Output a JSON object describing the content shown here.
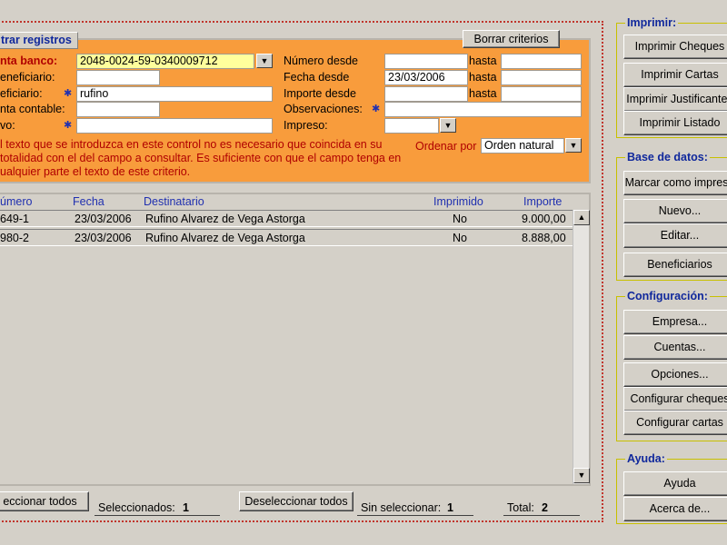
{
  "filter": {
    "title": "trar registros",
    "clear_label": "Borrar criterios",
    "cuenta_banco_label": "nta banco:",
    "cuenta_banco_value": "2048-0024-59-0340009712",
    "beneficiario1_label": "eneficiario:",
    "beneficiario2_label": "eficiario:",
    "beneficiario2_value": "rufino",
    "cuenta_contable_label": "nta contable:",
    "motivo_label": "vo:",
    "numero_desde_label": "Número desde",
    "fecha_desde_label": "Fecha desde",
    "fecha_desde_value": "23/03/2006",
    "importe_desde_label": "Importe desde",
    "observaciones_label": "Observaciones:",
    "impreso_label": "Impreso:",
    "hasta_label": "hasta",
    "help_line1": "l texto que se introduzca en este control no es necesario que coincida en su",
    "help_line2": "totalidad con el del campo a consultar. Es suficiente con que el campo tenga en",
    "help_line3": "ualquier parte el texto de este criterio.",
    "ordenar_label": "Ordenar por",
    "ordenar_value": "Orden natural"
  },
  "table": {
    "headers": [
      "úmero",
      "Fecha",
      "Destinatario",
      "Imprimido",
      "Importe"
    ],
    "rows": [
      [
        "649-1",
        "23/03/2006",
        "Rufino Alvarez de Vega Astorga",
        "No",
        "9.000,00"
      ],
      [
        "980-2",
        "23/03/2006",
        "Rufino Alvarez de Vega Astorga",
        "No",
        "8.888,00"
      ]
    ]
  },
  "status": {
    "select_all": "eccionar todos",
    "selected_label": "Seleccionados:",
    "selected_count": "1",
    "deselect_all": "Deseleccionar todos",
    "unselected_label": "Sin seleccionar:",
    "unselected_count": "1",
    "total_label": "Total:",
    "total_count": "2"
  },
  "sidebar": {
    "imprimir": {
      "title": "Imprimir:",
      "buttons": [
        "Imprimir Cheques",
        "Imprimir Cartas",
        "Imprimir Justificantes",
        "Imprimir Listado"
      ]
    },
    "base_datos": {
      "title": "Base de datos:",
      "buttons": [
        "Marcar como impreso",
        "Nuevo...",
        "Editar...",
        "Beneficiarios"
      ]
    },
    "configuracion": {
      "title": "Configuración:",
      "buttons": [
        "Empresa...",
        "Cuentas...",
        "Opciones...",
        "Configurar cheques",
        "Configurar cartas"
      ]
    },
    "ayuda": {
      "title": "Ayuda:",
      "buttons": [
        "Ayuda",
        "Acerca de..."
      ]
    }
  },
  "colors": {
    "panel_orange": "#f89c3c",
    "title_blue": "#10289c",
    "label_red": "#b00000",
    "field_yellow": "#ffff9c",
    "frame_red": "#c0342b"
  }
}
